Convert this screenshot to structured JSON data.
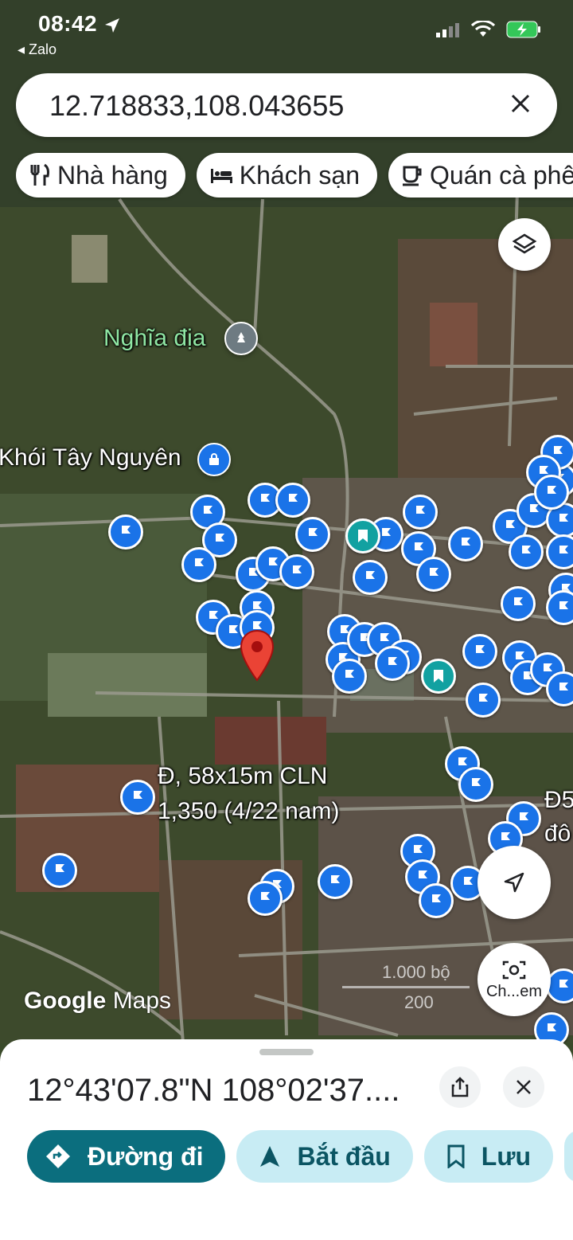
{
  "status": {
    "time": "08:42",
    "back_app": "◂ Zalo"
  },
  "search": {
    "query": "12.718833,108.043655"
  },
  "chips": [
    {
      "label": "Nhà hàng",
      "icon": "restaurant-icon"
    },
    {
      "label": "Khách sạn",
      "icon": "hotel-icon"
    },
    {
      "label": "Quán cà phê",
      "icon": "cafe-icon"
    }
  ],
  "map": {
    "labels": {
      "cemetery": "Nghĩa địa",
      "store": "Khói Tây Nguyên",
      "listing_line1": "Đ, 58x15m CLN",
      "listing_line2": "1,350 (4/22 nam)",
      "edge_line1": "Đ5",
      "edge_line2": "đô"
    },
    "scale": {
      "top": "1.000 bộ",
      "bottom": "200"
    },
    "screenshot_button": "Ch...em",
    "logo": {
      "google": "Google",
      "maps": "Maps"
    }
  },
  "sheet": {
    "coordinates": "12°43'07.8\"N 108°02'37....",
    "actions": {
      "directions": "Đường đi",
      "start": "Bắt đầu",
      "save": "Lưu"
    }
  },
  "colors": {
    "primary": "#0b6e7e",
    "secondary": "#c8ecf4",
    "pin": "#1a73e8",
    "marker": "#ea4335"
  }
}
